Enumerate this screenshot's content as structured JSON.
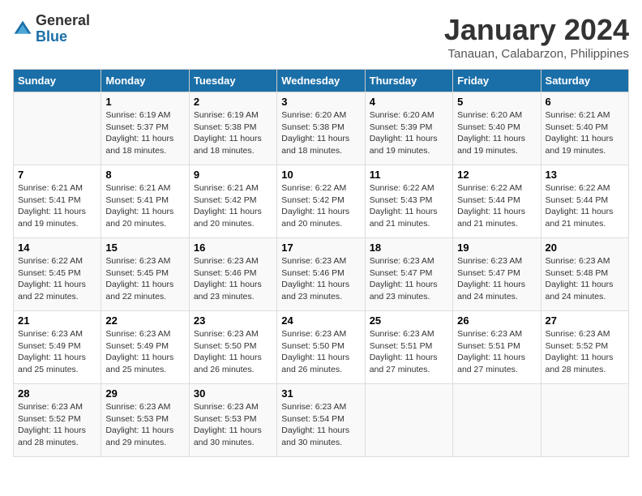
{
  "header": {
    "logo_general": "General",
    "logo_blue": "Blue",
    "month_year": "January 2024",
    "location": "Tanauan, Calabarzon, Philippines"
  },
  "days_of_week": [
    "Sunday",
    "Monday",
    "Tuesday",
    "Wednesday",
    "Thursday",
    "Friday",
    "Saturday"
  ],
  "weeks": [
    [
      {
        "day": "",
        "sunrise": "",
        "sunset": "",
        "daylight": ""
      },
      {
        "day": "1",
        "sunrise": "Sunrise: 6:19 AM",
        "sunset": "Sunset: 5:37 PM",
        "daylight": "Daylight: 11 hours and 18 minutes."
      },
      {
        "day": "2",
        "sunrise": "Sunrise: 6:19 AM",
        "sunset": "Sunset: 5:38 PM",
        "daylight": "Daylight: 11 hours and 18 minutes."
      },
      {
        "day": "3",
        "sunrise": "Sunrise: 6:20 AM",
        "sunset": "Sunset: 5:38 PM",
        "daylight": "Daylight: 11 hours and 18 minutes."
      },
      {
        "day": "4",
        "sunrise": "Sunrise: 6:20 AM",
        "sunset": "Sunset: 5:39 PM",
        "daylight": "Daylight: 11 hours and 19 minutes."
      },
      {
        "day": "5",
        "sunrise": "Sunrise: 6:20 AM",
        "sunset": "Sunset: 5:40 PM",
        "daylight": "Daylight: 11 hours and 19 minutes."
      },
      {
        "day": "6",
        "sunrise": "Sunrise: 6:21 AM",
        "sunset": "Sunset: 5:40 PM",
        "daylight": "Daylight: 11 hours and 19 minutes."
      }
    ],
    [
      {
        "day": "7",
        "sunrise": "Sunrise: 6:21 AM",
        "sunset": "Sunset: 5:41 PM",
        "daylight": "Daylight: 11 hours and 19 minutes."
      },
      {
        "day": "8",
        "sunrise": "Sunrise: 6:21 AM",
        "sunset": "Sunset: 5:41 PM",
        "daylight": "Daylight: 11 hours and 20 minutes."
      },
      {
        "day": "9",
        "sunrise": "Sunrise: 6:21 AM",
        "sunset": "Sunset: 5:42 PM",
        "daylight": "Daylight: 11 hours and 20 minutes."
      },
      {
        "day": "10",
        "sunrise": "Sunrise: 6:22 AM",
        "sunset": "Sunset: 5:42 PM",
        "daylight": "Daylight: 11 hours and 20 minutes."
      },
      {
        "day": "11",
        "sunrise": "Sunrise: 6:22 AM",
        "sunset": "Sunset: 5:43 PM",
        "daylight": "Daylight: 11 hours and 21 minutes."
      },
      {
        "day": "12",
        "sunrise": "Sunrise: 6:22 AM",
        "sunset": "Sunset: 5:44 PM",
        "daylight": "Daylight: 11 hours and 21 minutes."
      },
      {
        "day": "13",
        "sunrise": "Sunrise: 6:22 AM",
        "sunset": "Sunset: 5:44 PM",
        "daylight": "Daylight: 11 hours and 21 minutes."
      }
    ],
    [
      {
        "day": "14",
        "sunrise": "Sunrise: 6:22 AM",
        "sunset": "Sunset: 5:45 PM",
        "daylight": "Daylight: 11 hours and 22 minutes."
      },
      {
        "day": "15",
        "sunrise": "Sunrise: 6:23 AM",
        "sunset": "Sunset: 5:45 PM",
        "daylight": "Daylight: 11 hours and 22 minutes."
      },
      {
        "day": "16",
        "sunrise": "Sunrise: 6:23 AM",
        "sunset": "Sunset: 5:46 PM",
        "daylight": "Daylight: 11 hours and 23 minutes."
      },
      {
        "day": "17",
        "sunrise": "Sunrise: 6:23 AM",
        "sunset": "Sunset: 5:46 PM",
        "daylight": "Daylight: 11 hours and 23 minutes."
      },
      {
        "day": "18",
        "sunrise": "Sunrise: 6:23 AM",
        "sunset": "Sunset: 5:47 PM",
        "daylight": "Daylight: 11 hours and 23 minutes."
      },
      {
        "day": "19",
        "sunrise": "Sunrise: 6:23 AM",
        "sunset": "Sunset: 5:47 PM",
        "daylight": "Daylight: 11 hours and 24 minutes."
      },
      {
        "day": "20",
        "sunrise": "Sunrise: 6:23 AM",
        "sunset": "Sunset: 5:48 PM",
        "daylight": "Daylight: 11 hours and 24 minutes."
      }
    ],
    [
      {
        "day": "21",
        "sunrise": "Sunrise: 6:23 AM",
        "sunset": "Sunset: 5:49 PM",
        "daylight": "Daylight: 11 hours and 25 minutes."
      },
      {
        "day": "22",
        "sunrise": "Sunrise: 6:23 AM",
        "sunset": "Sunset: 5:49 PM",
        "daylight": "Daylight: 11 hours and 25 minutes."
      },
      {
        "day": "23",
        "sunrise": "Sunrise: 6:23 AM",
        "sunset": "Sunset: 5:50 PM",
        "daylight": "Daylight: 11 hours and 26 minutes."
      },
      {
        "day": "24",
        "sunrise": "Sunrise: 6:23 AM",
        "sunset": "Sunset: 5:50 PM",
        "daylight": "Daylight: 11 hours and 26 minutes."
      },
      {
        "day": "25",
        "sunrise": "Sunrise: 6:23 AM",
        "sunset": "Sunset: 5:51 PM",
        "daylight": "Daylight: 11 hours and 27 minutes."
      },
      {
        "day": "26",
        "sunrise": "Sunrise: 6:23 AM",
        "sunset": "Sunset: 5:51 PM",
        "daylight": "Daylight: 11 hours and 27 minutes."
      },
      {
        "day": "27",
        "sunrise": "Sunrise: 6:23 AM",
        "sunset": "Sunset: 5:52 PM",
        "daylight": "Daylight: 11 hours and 28 minutes."
      }
    ],
    [
      {
        "day": "28",
        "sunrise": "Sunrise: 6:23 AM",
        "sunset": "Sunset: 5:52 PM",
        "daylight": "Daylight: 11 hours and 28 minutes."
      },
      {
        "day": "29",
        "sunrise": "Sunrise: 6:23 AM",
        "sunset": "Sunset: 5:53 PM",
        "daylight": "Daylight: 11 hours and 29 minutes."
      },
      {
        "day": "30",
        "sunrise": "Sunrise: 6:23 AM",
        "sunset": "Sunset: 5:53 PM",
        "daylight": "Daylight: 11 hours and 30 minutes."
      },
      {
        "day": "31",
        "sunrise": "Sunrise: 6:23 AM",
        "sunset": "Sunset: 5:54 PM",
        "daylight": "Daylight: 11 hours and 30 minutes."
      },
      {
        "day": "",
        "sunrise": "",
        "sunset": "",
        "daylight": ""
      },
      {
        "day": "",
        "sunrise": "",
        "sunset": "",
        "daylight": ""
      },
      {
        "day": "",
        "sunrise": "",
        "sunset": "",
        "daylight": ""
      }
    ]
  ]
}
